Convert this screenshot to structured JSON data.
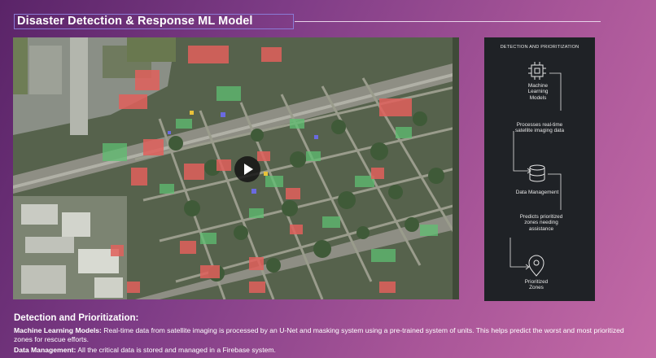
{
  "slide": {
    "title": "Disaster Detection & Response ML Model"
  },
  "video": {
    "play_icon": "play-icon"
  },
  "diagram": {
    "heading": "DETECTION AND PRIORITIZATION",
    "node1": "Machine Learning Models",
    "edge1": "Processes real-time satellite imaging data",
    "node2": "Data Management",
    "edge2": "Predicts prioritized zones needing assistance",
    "node3": "Prioritized Zones",
    "icons": [
      "chip-icon",
      "database-icon",
      "location-pin-icon"
    ]
  },
  "body": {
    "heading": "Detection and Prioritization:",
    "items": [
      {
        "label": "Machine Learning Models:",
        "text": " Real-time data from satellite imaging is processed by an U-Net and masking system using a pre-trained system of units. This helps predict the worst and most prioritized zones for rescue efforts."
      },
      {
        "label": "Data Management:",
        "text": " All the critical data is stored and managed in a Firebase system."
      }
    ]
  },
  "colors": {
    "accent_border": "#8a7bd6",
    "mask_red": "#e0605c",
    "mask_green": "#5fbf72",
    "panel_bg": "#1f2226"
  }
}
